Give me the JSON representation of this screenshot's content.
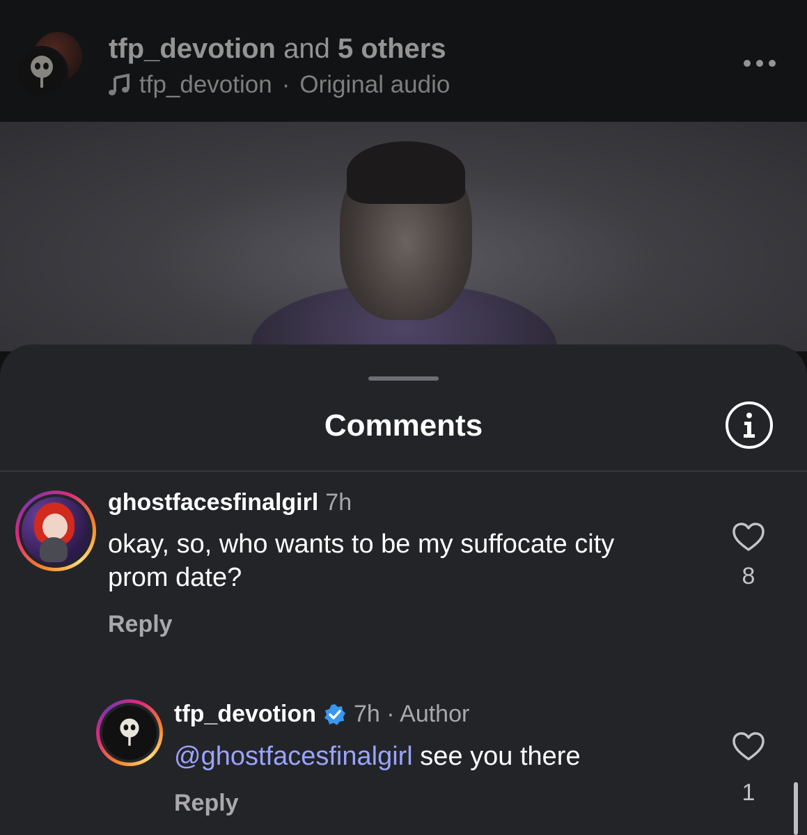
{
  "post_header": {
    "username": "tfp_devotion",
    "and_text": "and",
    "others": "5 others",
    "audio_owner": "tfp_devotion",
    "audio_sep": "·",
    "audio_label": "Original audio",
    "music_icon": "music-note-icon",
    "more_icon": "more-horizontal-icon"
  },
  "sheet": {
    "title": "Comments",
    "info_icon": "info-icon"
  },
  "comments": [
    {
      "username": "ghostfacesfinalgirl",
      "time": "7h",
      "text_line1": "okay, so, who wants to be my suffocate city",
      "text_line2": "prom date?",
      "reply_label": "Reply",
      "likes": "8"
    },
    {
      "username": "tfp_devotion",
      "verified_icon": "verified-badge-icon",
      "meta": "7h · Author",
      "mention": "@ghostfacesfinalgirl",
      "text": " see you there",
      "reply_label": "Reply",
      "likes": "1"
    }
  ],
  "colors": {
    "sheet_bg": "#232428",
    "mention": "#9aa4ff",
    "verified": "#3897f0",
    "secondary_text": "#a8a8ad"
  }
}
